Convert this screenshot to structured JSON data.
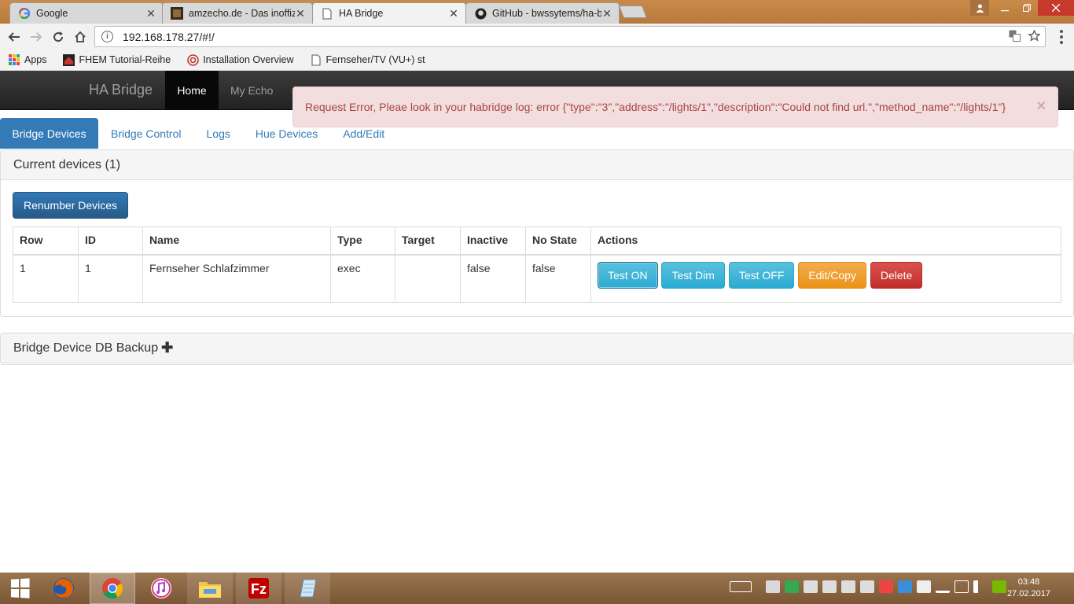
{
  "browser": {
    "tabs": [
      {
        "title": "Google",
        "favicon": "google-icon"
      },
      {
        "title": "amzecho.de - Das inoffiz",
        "favicon": "amzecho-icon"
      },
      {
        "title": "HA Bridge",
        "favicon": "document-icon"
      },
      {
        "title": "GitHub - bwssytems/ha-b",
        "favicon": "github-icon"
      }
    ],
    "close_glyph": "✕",
    "url": "192.168.178.27/#!/",
    "bookmarks": [
      {
        "label": "Apps",
        "icon": "apps-grid-icon"
      },
      {
        "label": "FHEM Tutorial-Reihe",
        "icon": "fhem-icon"
      },
      {
        "label": "Installation Overview",
        "icon": "installation-icon"
      },
      {
        "label": "Fernseher/TV (VU+) st",
        "icon": "document-icon"
      }
    ]
  },
  "navbar": {
    "brand": "HA Bridge",
    "items": [
      "Home",
      "My Echo"
    ]
  },
  "alert": {
    "message": "Request Error, Pleae look in your habridge log: error {\"type\":\"3\",\"address\":\"/lights/1\",\"description\":\"Could not find url.\",\"method_name\":\"/lights/1\"}",
    "close": "×"
  },
  "tabs": [
    "Bridge Devices",
    "Bridge Control",
    "Logs",
    "Hue Devices",
    "Add/Edit"
  ],
  "devices_panel": {
    "title": "Current devices (1)",
    "renumber_label": "Renumber Devices",
    "columns": [
      "Row",
      "ID",
      "Name",
      "Type",
      "Target",
      "Inactive",
      "No State",
      "Actions"
    ],
    "rows": [
      {
        "row": "1",
        "id": "1",
        "name": "Fernseher Schlafzimmer",
        "type": "exec",
        "target": "",
        "inactive": "false",
        "nostate": "false"
      }
    ],
    "actions": [
      "Test ON",
      "Test Dim",
      "Test OFF",
      "Edit/Copy",
      "Delete"
    ]
  },
  "backup_panel": {
    "title": "Bridge Device DB Backup",
    "plus": "✚"
  },
  "taskbar": {
    "apps": [
      "firefox-icon",
      "chrome-icon",
      "itunes-icon",
      "file-explorer-icon",
      "filezilla-icon",
      "notepad-icon"
    ],
    "time": "03:48",
    "date": "27.02.2017"
  },
  "colors": {
    "primary": "#337ab7",
    "info": "#5bc0de",
    "warning": "#f0ad4e",
    "danger": "#d9534f",
    "alert_bg": "#f2dede",
    "alert_text": "#a94442"
  }
}
